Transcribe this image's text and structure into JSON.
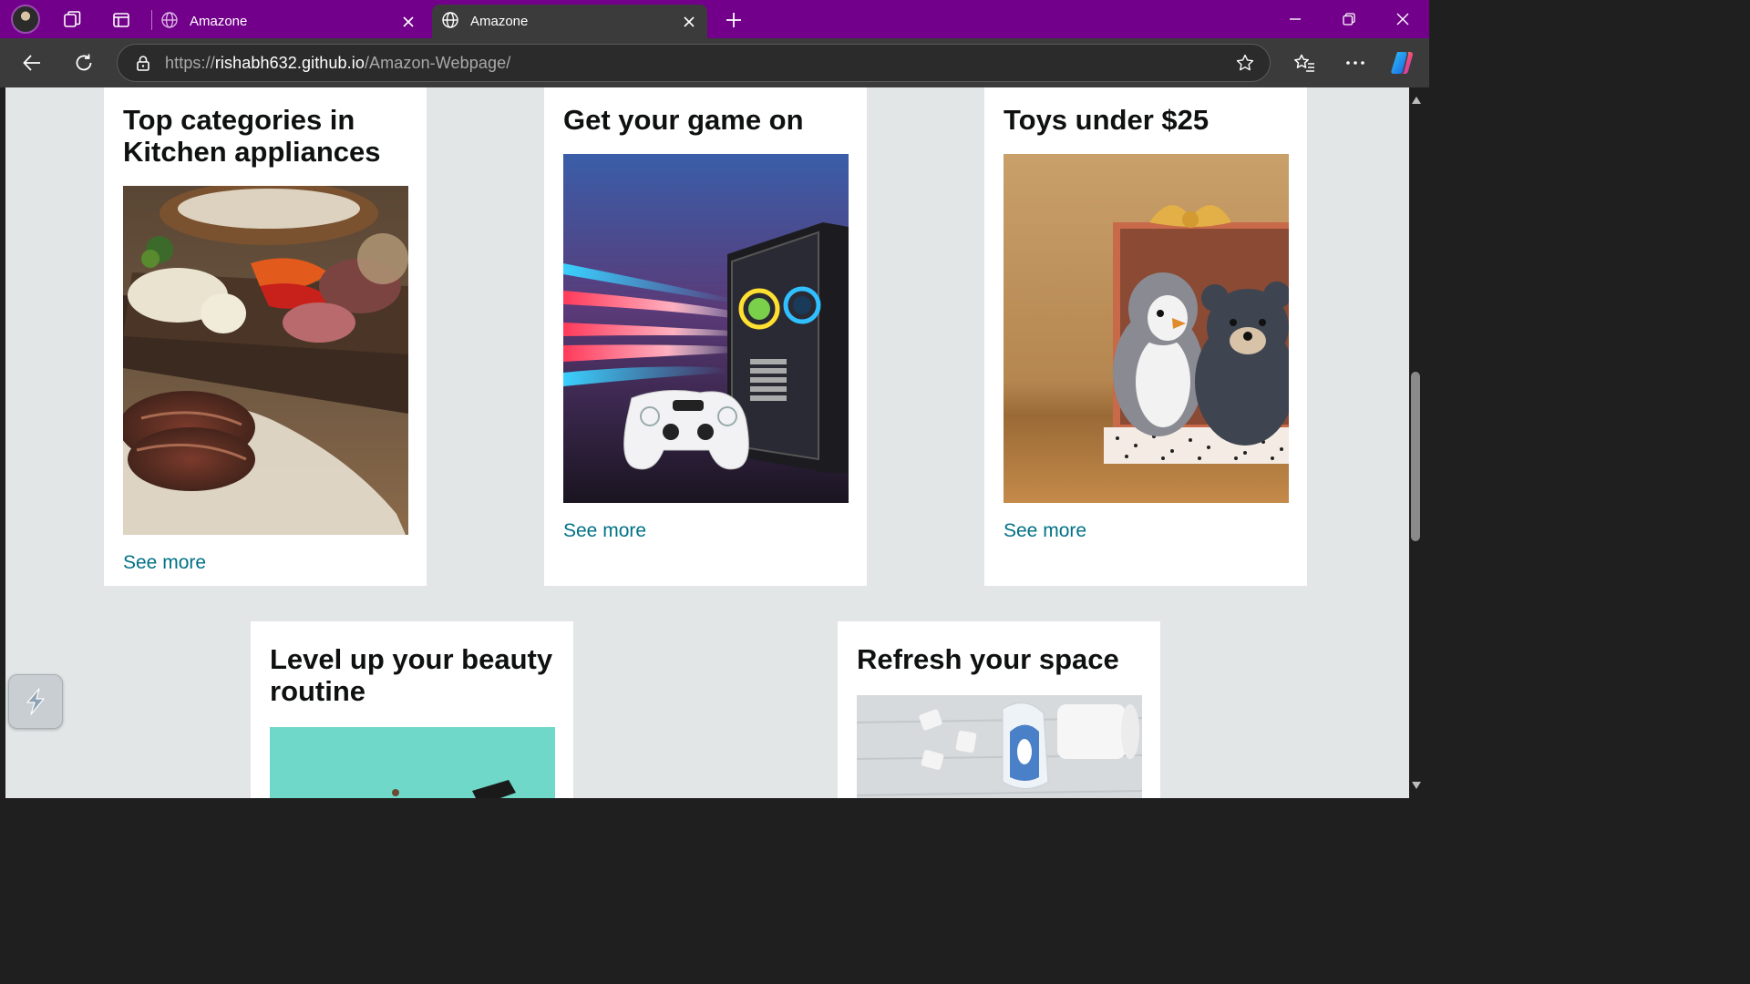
{
  "browser": {
    "tabs": [
      {
        "title": "Amazone",
        "active": false
      },
      {
        "title": "Amazone",
        "active": true
      }
    ],
    "address": {
      "scheme": "https://",
      "host": "rishabh632.github.io",
      "path": "/Amazon-Webpage/"
    },
    "icons": {
      "profile": "profile-avatar",
      "workspaces": "workspaces-icon",
      "tab_actions": "tab-actions-icon",
      "tab_favicon": "globe-icon",
      "new_tab": "plus-icon",
      "back": "arrow-left-icon",
      "refresh": "refresh-icon",
      "site_info": "lock-icon",
      "favorite": "star-icon",
      "favorites_bar": "favorites-icon",
      "more": "more-icon",
      "copilot": "copilot-icon"
    },
    "theme_color": "#72008a"
  },
  "page": {
    "row1": [
      {
        "title_line1": "Top categories in",
        "title_line2": "Kitchen appliances",
        "link": "See more",
        "image": "kitchen-food-image"
      },
      {
        "title_line1": "Get your game on",
        "title_line2": "",
        "link": "See more",
        "image": "gaming-pc-controller-image"
      },
      {
        "title_line1": "Toys under $25",
        "title_line2": "",
        "link": "See more",
        "image": "plush-toys-image"
      }
    ],
    "row2": [
      {
        "title_line1": "Level up your beauty",
        "title_line2": "routine",
        "image": "beauty-products-image"
      },
      {
        "title_line1": "Refresh your space",
        "title_line2": "",
        "image": "home-cleaning-image"
      }
    ],
    "colors": {
      "background": "#e3e6e6",
      "card": "#ffffff",
      "link": "#007185",
      "heading": "#0f1111"
    }
  }
}
